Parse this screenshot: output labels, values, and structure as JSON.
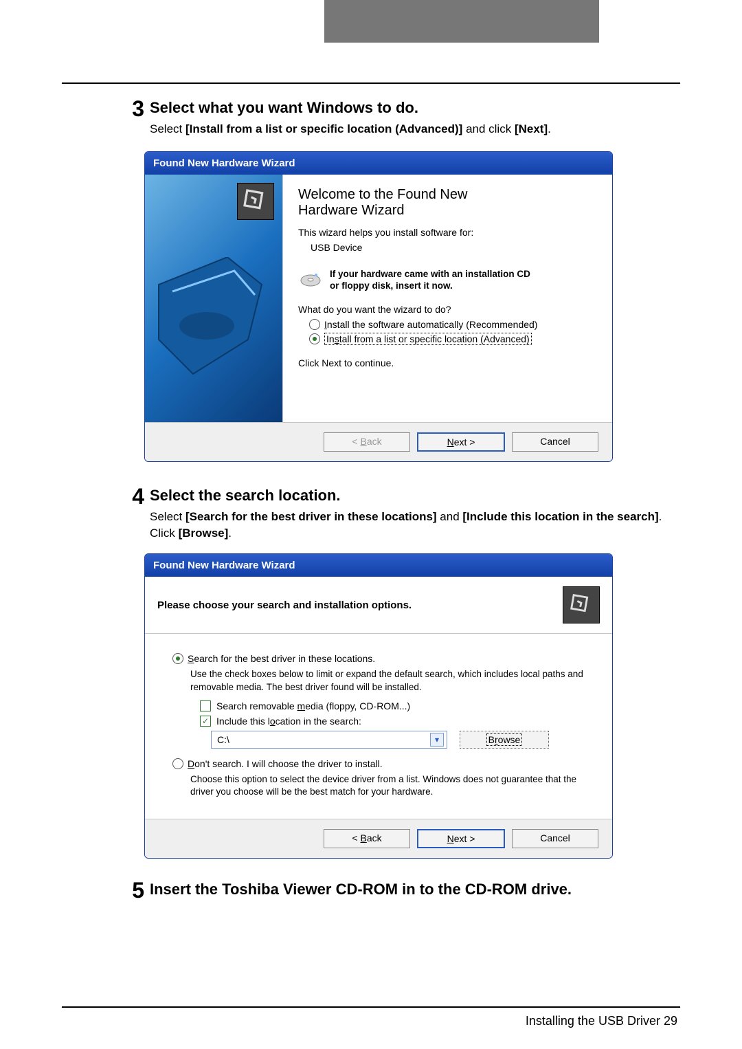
{
  "step3": {
    "num": "3",
    "title": "Select what you want Windows to do.",
    "desc_pre": "Select ",
    "desc_bold": "[Install from a list or specific location (Advanced)]",
    "desc_mid": " and click ",
    "desc_bold2": "[Next]",
    "desc_end": "."
  },
  "wiz1": {
    "titlebar": "Found New Hardware Wizard",
    "welcome_l1": "Welcome to the Found New",
    "welcome_l2": "Hardware Wizard",
    "helps": "This wizard helps you install software for:",
    "device": "USB Device",
    "cd_l1": "If your hardware came with an installation CD",
    "cd_l2": "or floppy disk, insert it now.",
    "q": "What do you want the wizard to do?",
    "opt_auto": "Install the software automatically (Recommended)",
    "opt_list": "Install from a list or specific location (Advanced)",
    "click_next": "Click Next to continue.",
    "btn_back": "< Back",
    "btn_next": "Next >",
    "btn_cancel": "Cancel"
  },
  "step4": {
    "num": "4",
    "title": "Select the search location.",
    "desc_pre": "Select ",
    "desc_b1": "[Search for the best driver in these locations]",
    "desc_mid1": " and ",
    "desc_b2": "[Include this location in the search]",
    "desc_mid2": ". Click ",
    "desc_b3": "[Browse]",
    "desc_end": "."
  },
  "wiz2": {
    "titlebar": "Found New Hardware Wizard",
    "head": "Please choose your search and installation options.",
    "opt_search": "Search for the best driver in these locations.",
    "search_desc": "Use the check boxes below to limit or expand the default search, which includes local paths and removable media. The best driver found will be installed.",
    "chk_removable": "Search removable media (floppy, CD-ROM...)",
    "chk_include": "Include this location in the search:",
    "path": "C:\\",
    "btn_browse": "Browse",
    "opt_dont": "Don't search. I will choose the driver to install.",
    "dont_desc": "Choose this option to select the device driver from a list.  Windows does not guarantee that the driver you choose will be the best match for your hardware.",
    "btn_back": "< Back",
    "btn_next": "Next >",
    "btn_cancel": "Cancel"
  },
  "step5": {
    "num": "5",
    "title": "Insert the Toshiba Viewer CD-ROM in to the CD-ROM drive."
  },
  "footer": {
    "text": "Installing the USB Driver    29"
  }
}
